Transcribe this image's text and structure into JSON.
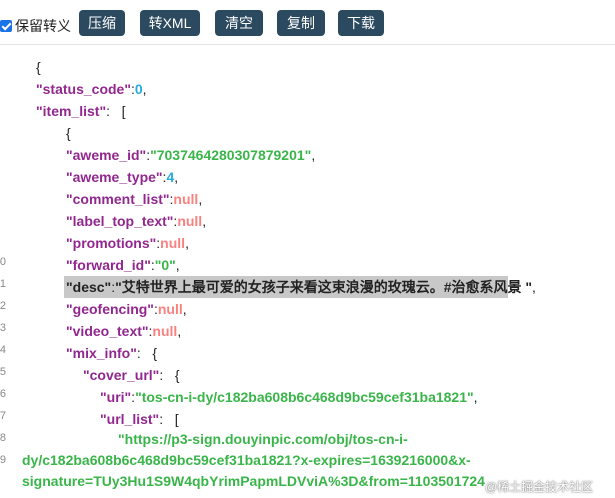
{
  "toolbar": {
    "keep_escape_label": "保留转义",
    "keep_escape_checked": true,
    "compress_label": "压缩",
    "to_xml_label": "转XML",
    "clear_label": "清空",
    "copy_label": "复制",
    "download_label": "下载",
    "button_color": "#2c4a5f"
  },
  "gutter_numbers": [
    "0",
    "1",
    "2",
    "3",
    "4",
    "5",
    "6",
    "7",
    "8",
    "9"
  ],
  "json_lines": [
    {
      "indent": 0,
      "tokens": [
        {
          "t": "p",
          "v": "{"
        }
      ]
    },
    {
      "indent": 0,
      "tokens": [
        {
          "t": "k",
          "v": "\"status_code\""
        },
        {
          "t": "p",
          "v": ":"
        },
        {
          "t": "n",
          "v": "0"
        },
        {
          "t": "p",
          "v": ","
        }
      ]
    },
    {
      "indent": 0,
      "tokens": [
        {
          "t": "k",
          "v": "\"item_list\""
        },
        {
          "t": "p",
          "v": ":   ["
        }
      ]
    },
    {
      "indent": 1,
      "tokens": [
        {
          "t": "p",
          "v": "{"
        }
      ]
    },
    {
      "indent": 1,
      "tokens": [
        {
          "t": "k",
          "v": "\"aweme_id\""
        },
        {
          "t": "p",
          "v": ":"
        },
        {
          "t": "s",
          "v": "\"7037464280307879201\""
        },
        {
          "t": "p",
          "v": ","
        }
      ]
    },
    {
      "indent": 1,
      "tokens": [
        {
          "t": "k",
          "v": "\"aweme_type\""
        },
        {
          "t": "p",
          "v": ":"
        },
        {
          "t": "n",
          "v": "4"
        },
        {
          "t": "p",
          "v": ","
        }
      ]
    },
    {
      "indent": 1,
      "tokens": [
        {
          "t": "k",
          "v": "\"comment_list\""
        },
        {
          "t": "p",
          "v": ":"
        },
        {
          "t": "nl",
          "v": "null"
        },
        {
          "t": "p",
          "v": ","
        }
      ]
    },
    {
      "indent": 1,
      "tokens": [
        {
          "t": "k",
          "v": "\"label_top_text\""
        },
        {
          "t": "p",
          "v": ":"
        },
        {
          "t": "nl",
          "v": "null"
        },
        {
          "t": "p",
          "v": ","
        }
      ]
    },
    {
      "indent": 1,
      "tokens": [
        {
          "t": "k",
          "v": "\"promotions\""
        },
        {
          "t": "p",
          "v": ":"
        },
        {
          "t": "nl",
          "v": "null"
        },
        {
          "t": "p",
          "v": ","
        }
      ]
    },
    {
      "indent": 1,
      "tokens": [
        {
          "t": "k",
          "v": "\"forward_id\""
        },
        {
          "t": "p",
          "v": ":"
        },
        {
          "t": "s",
          "v": "\"0\""
        },
        {
          "t": "p",
          "v": ","
        }
      ]
    },
    {
      "indent": 1,
      "selected": true,
      "tokens": [
        {
          "t": "k",
          "v": "\"desc\""
        },
        {
          "t": "p",
          "v": ":"
        },
        {
          "t": "s",
          "v": "\"艾特世界上最可爱的女孩子来看这束浪漫的玫瑰云。#治愈系风景 \""
        },
        {
          "t": "p",
          "v": ","
        }
      ]
    },
    {
      "indent": 1,
      "tokens": [
        {
          "t": "k",
          "v": "\"geofencing\""
        },
        {
          "t": "p",
          "v": ":"
        },
        {
          "t": "nl",
          "v": "null"
        },
        {
          "t": "p",
          "v": ","
        }
      ]
    },
    {
      "indent": 1,
      "tokens": [
        {
          "t": "k",
          "v": "\"video_text\""
        },
        {
          "t": "p",
          "v": ":"
        },
        {
          "t": "nl",
          "v": "null"
        },
        {
          "t": "p",
          "v": ","
        }
      ]
    },
    {
      "indent": 1,
      "tokens": [
        {
          "t": "k",
          "v": "\"mix_info\""
        },
        {
          "t": "p",
          "v": ":   {"
        }
      ]
    },
    {
      "indent": 2,
      "tokens": [
        {
          "t": "k",
          "v": "\"cover_url\""
        },
        {
          "t": "p",
          "v": ":   {"
        }
      ]
    },
    {
      "indent": 3,
      "tokens": [
        {
          "t": "k",
          "v": "\"uri\""
        },
        {
          "t": "p",
          "v": ":"
        },
        {
          "t": "s",
          "v": "\"tos-cn-i-dy/c182ba608b6c468d9bc59cef31ba1821\""
        },
        {
          "t": "p",
          "v": ","
        }
      ]
    },
    {
      "indent": 3,
      "tokens": [
        {
          "t": "k",
          "v": "\"url_list\""
        },
        {
          "t": "p",
          "v": ":   ["
        }
      ]
    }
  ],
  "wrapped_url_lines": [
    "\"https://p3-sign.douyinpic.com/obj/tos-cn-i-",
    "dy/c182ba608b6c468d9bc59cef31ba1821?x-expires=1639216000&x-",
    "signature=TUy3Hu1S9W4qbYrimPapmLDVviA%3D&from=1103501724"
  ],
  "watermark_text": "@稀土掘金技术社区"
}
